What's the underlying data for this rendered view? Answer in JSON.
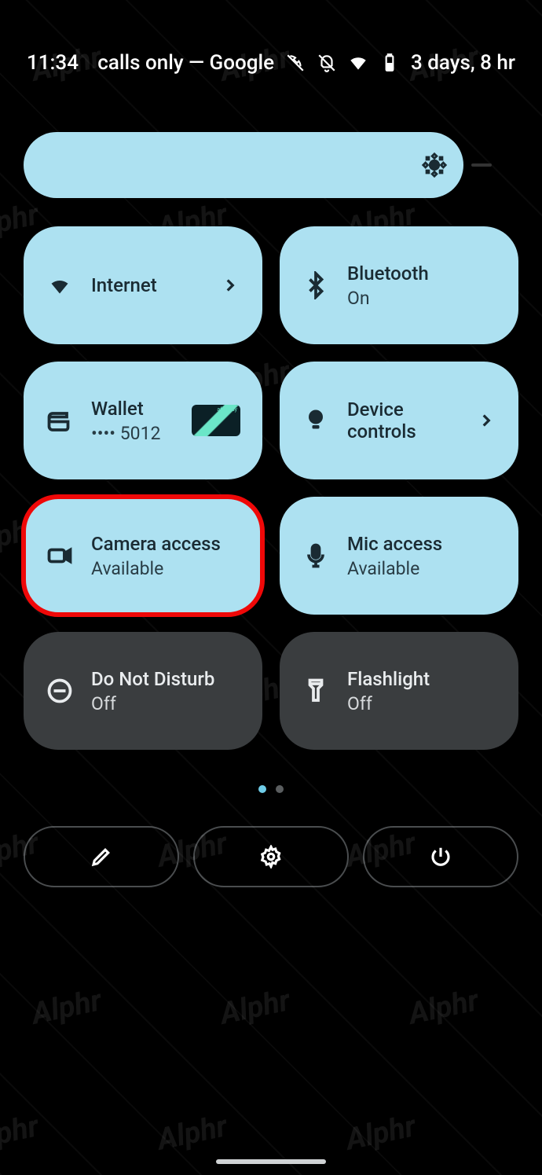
{
  "status": {
    "time": "11:34",
    "carrier": "calls only — Google",
    "battery_text": "3 days, 8 hr"
  },
  "tiles": {
    "internet": {
      "title": "Internet",
      "sub": ""
    },
    "bluetooth": {
      "title": "Bluetooth",
      "sub": "On"
    },
    "wallet": {
      "title": "Wallet",
      "sub": "•••• 5012"
    },
    "device_controls": {
      "title": "Device controls",
      "sub": ""
    },
    "camera": {
      "title": "Camera access",
      "sub": "Available"
    },
    "mic": {
      "title": "Mic access",
      "sub": "Available"
    },
    "dnd": {
      "title": "Do Not Disturb",
      "sub": "Off"
    },
    "flashlight": {
      "title": "Flashlight",
      "sub": "Off"
    }
  },
  "watermark": "Alphr"
}
